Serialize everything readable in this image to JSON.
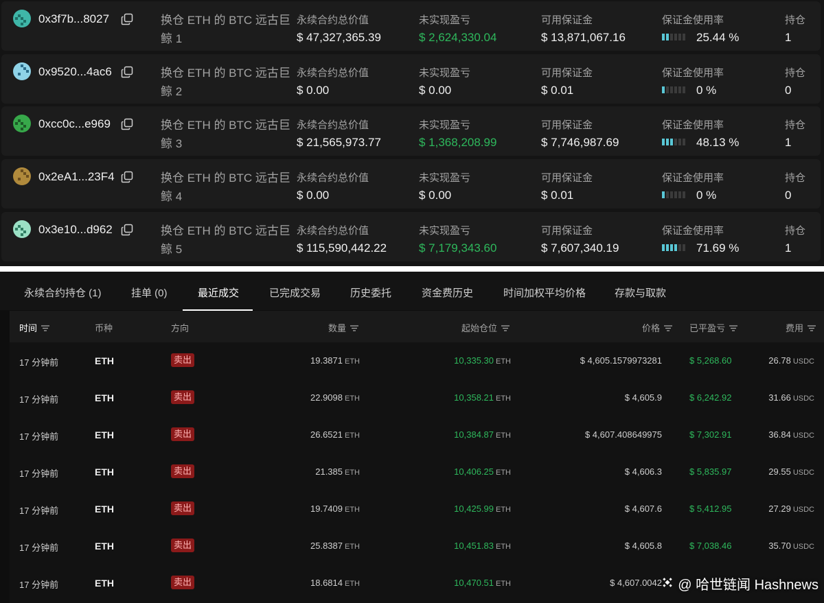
{
  "wallets": [
    {
      "address": "0x3f7b...8027",
      "label": "换仓 ETH 的 BTC 远古巨鲸 1",
      "notional": "$ 47,327,365.39",
      "pnl": "$ 2,624,330.04",
      "margin": "$ 13,871,067.16",
      "usage": "25.44 %",
      "usage_fraction": 0.2544,
      "positions": "1"
    },
    {
      "address": "0x9520...4ac6",
      "label": "换仓 ETH 的 BTC 远古巨鲸 2",
      "notional": "$ 0.00",
      "pnl": "$ 0.00",
      "margin": "$ 0.01",
      "usage": "0 %",
      "usage_fraction": 0,
      "positions": "0"
    },
    {
      "address": "0xcc0c...e969",
      "label": "换仓 ETH 的 BTC 远古巨鲸 3",
      "notional": "$ 21,565,973.77",
      "pnl": "$ 1,368,208.99",
      "margin": "$ 7,746,987.69",
      "usage": "48.13 %",
      "usage_fraction": 0.4813,
      "positions": "1"
    },
    {
      "address": "0x2eA1...23F4",
      "label": "换仓 ETH 的 BTC 远古巨鲸 4",
      "notional": "$ 0.00",
      "pnl": "$ 0.00",
      "margin": "$ 0.01",
      "usage": "0 %",
      "usage_fraction": 0,
      "positions": "0"
    },
    {
      "address": "0x3e10...d962",
      "label": "换仓 ETH 的 BTC 远古巨鲸 5",
      "notional": "$ 115,590,442.22",
      "pnl": "$ 7,179,343.60",
      "margin": "$ 7,607,340.19",
      "usage": "71.69 %",
      "usage_fraction": 0.7169,
      "positions": "1"
    }
  ],
  "wallet_labels": {
    "notional": "永续合约总价值",
    "pnl": "未实现盈亏",
    "margin": "可用保证金",
    "usage": "保证金使用率",
    "positions": "持仓"
  },
  "colors": {
    "positive": "#2eb85c",
    "meter_on": "#59c7d6",
    "sell_badge": "#8b1a1a"
  },
  "tabs": [
    {
      "label": "永续合约持仓 (1)",
      "active": false
    },
    {
      "label": "挂单 (0)",
      "active": false
    },
    {
      "label": "最近成交",
      "active": true
    },
    {
      "label": "已完成交易",
      "active": false
    },
    {
      "label": "历史委托",
      "active": false
    },
    {
      "label": "资金费历史",
      "active": false
    },
    {
      "label": "时间加权平均价格",
      "active": false
    },
    {
      "label": "存款与取款",
      "active": false
    }
  ],
  "table": {
    "headers": [
      "时间",
      "币种",
      "方向",
      "数量",
      "起始仓位",
      "价格",
      "已平盈亏",
      "费用"
    ],
    "rows": [
      {
        "time": "17 分钟前",
        "coin": "ETH",
        "side": "卖出",
        "qty": "19.3871",
        "qty_unit": "ETH",
        "start_pos": "10,335.30",
        "start_unit": "ETH",
        "price": "$ 4,605.1579973281",
        "pnl": "$ 5,268.60",
        "fee": "26.78",
        "fee_unit": "USDC"
      },
      {
        "time": "17 分钟前",
        "coin": "ETH",
        "side": "卖出",
        "qty": "22.9098",
        "qty_unit": "ETH",
        "start_pos": "10,358.21",
        "start_unit": "ETH",
        "price": "$ 4,605.9",
        "pnl": "$ 6,242.92",
        "fee": "31.66",
        "fee_unit": "USDC"
      },
      {
        "time": "17 分钟前",
        "coin": "ETH",
        "side": "卖出",
        "qty": "26.6521",
        "qty_unit": "ETH",
        "start_pos": "10,384.87",
        "start_unit": "ETH",
        "price": "$ 4,607.408649975",
        "pnl": "$ 7,302.91",
        "fee": "36.84",
        "fee_unit": "USDC"
      },
      {
        "time": "17 分钟前",
        "coin": "ETH",
        "side": "卖出",
        "qty": "21.385",
        "qty_unit": "ETH",
        "start_pos": "10,406.25",
        "start_unit": "ETH",
        "price": "$ 4,606.3",
        "pnl": "$ 5,835.97",
        "fee": "29.55",
        "fee_unit": "USDC"
      },
      {
        "time": "17 分钟前",
        "coin": "ETH",
        "side": "卖出",
        "qty": "19.7409",
        "qty_unit": "ETH",
        "start_pos": "10,425.99",
        "start_unit": "ETH",
        "price": "$ 4,607.6",
        "pnl": "$ 5,412.95",
        "fee": "27.29",
        "fee_unit": "USDC"
      },
      {
        "time": "17 分钟前",
        "coin": "ETH",
        "side": "卖出",
        "qty": "25.8387",
        "qty_unit": "ETH",
        "start_pos": "10,451.83",
        "start_unit": "ETH",
        "price": "$ 4,605.8",
        "pnl": "$ 7,038.46",
        "fee": "35.70",
        "fee_unit": "USDC"
      },
      {
        "time": "17 分钟前",
        "coin": "ETH",
        "side": "卖出",
        "qty": "18.6814",
        "qty_unit": "ETH",
        "start_pos": "10,470.51",
        "start_unit": "ETH",
        "price": "$ 4,607.0042",
        "pnl": "",
        "fee": "",
        "fee_unit": ""
      }
    ]
  },
  "watermark": "@ 哈世链闻 Hashnews"
}
